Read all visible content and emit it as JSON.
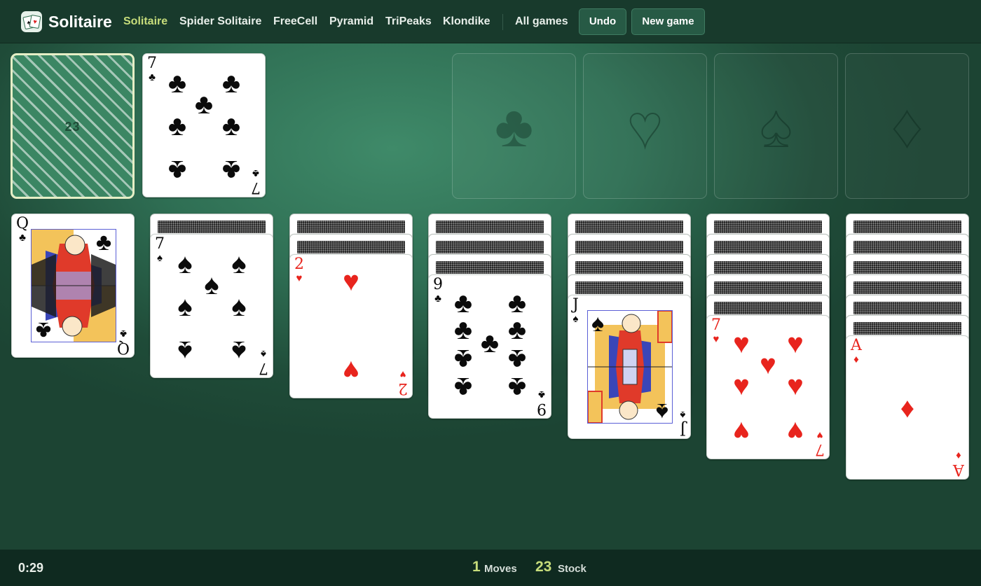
{
  "header": {
    "logo_text": "Solitaire",
    "nav": [
      "Solitaire",
      "Spider Solitaire",
      "FreeCell",
      "Pyramid",
      "TriPeaks",
      "Klondike",
      "All games"
    ],
    "undo_label": "Undo",
    "new_game_label": "New game"
  },
  "stock": {
    "count": "23"
  },
  "waste": {
    "rank": "7",
    "suit": "♣",
    "color": "black"
  },
  "foundations": [
    {
      "suit": "♣"
    },
    {
      "suit": "♥"
    },
    {
      "suit": "♠"
    },
    {
      "suit": "♦"
    }
  ],
  "tableau": [
    {
      "hidden": 0,
      "top": {
        "rank": "Q",
        "suit": "♣",
        "color": "black"
      }
    },
    {
      "hidden": 1,
      "top": {
        "rank": "7",
        "suit": "♠",
        "color": "black"
      }
    },
    {
      "hidden": 2,
      "top": {
        "rank": "2",
        "suit": "♥",
        "color": "red"
      }
    },
    {
      "hidden": 3,
      "top": {
        "rank": "9",
        "suit": "♣",
        "color": "black"
      }
    },
    {
      "hidden": 4,
      "top": {
        "rank": "J",
        "suit": "♠",
        "color": "black"
      }
    },
    {
      "hidden": 5,
      "top": {
        "rank": "7",
        "suit": "♥",
        "color": "red"
      }
    },
    {
      "hidden": 6,
      "top": {
        "rank": "A",
        "suit": "♦",
        "color": "red"
      }
    }
  ],
  "footer": {
    "timer": "0:29",
    "moves_value": "1",
    "moves_label": "Moves",
    "stock_value": "23",
    "stock_label": "Stock"
  },
  "colors": {
    "accent": "#c7dd7b",
    "red_suit": "#e8241d",
    "black_suit": "#0b0b0b"
  }
}
